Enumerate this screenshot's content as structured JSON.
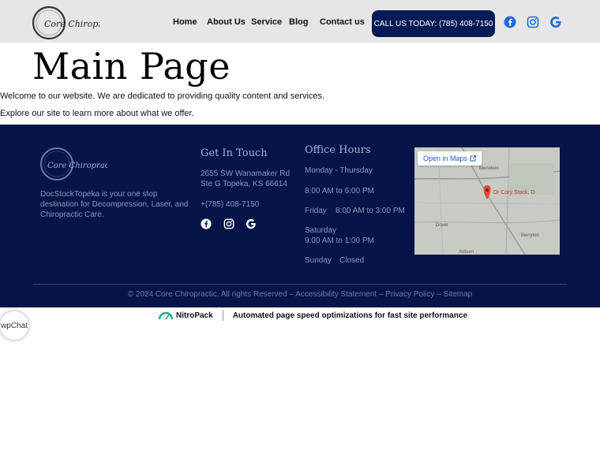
{
  "header": {
    "logo_text": "Core Chiropractic",
    "nav": [
      "Home",
      "About Us",
      "Service",
      "Blog",
      "Contact us"
    ],
    "cta": "CALL US TODAY: (785) 408-7150",
    "social_icons": [
      "facebook-icon",
      "instagram-icon",
      "google-icon"
    ],
    "accent": "#061a55"
  },
  "main": {
    "title": "Main Page",
    "paragraphs": [
      "Welcome to our website. We are dedicated to providing quality content and services.",
      "Explore our site to learn more about what we offer."
    ]
  },
  "footer": {
    "logo_text": "Core Chiropractic",
    "about": "DocStockTopeka is your one stop destination for Decompression, Laser, and Chiropractic Care.",
    "contact": {
      "heading": "Get In Touch",
      "address_line1": "2655 SW Wanamaker Rd",
      "address_line2": "Ste G Topeka, KS 66614",
      "phone": "+(785) 408-7150"
    },
    "hours": {
      "heading": "Office Hours",
      "weekdays_label": "Monday - Thursday",
      "weekdays_hours": "8:00 AM to 6:00 PM",
      "friday_label": "Friday",
      "friday_hours": "8:00 AM to 3:00 PM",
      "saturday_label": "Saturday",
      "saturday_hours": "9:00 AM to 1:00 PM",
      "sunday_label": "Sunday",
      "sunday_hours": "Closed"
    },
    "map": {
      "button": "Open in Maps",
      "pin_label": "Dr Cory Stock, D",
      "towns": [
        "Dover",
        "Auburn",
        "Berryton",
        "Menoken"
      ]
    },
    "copyright": "© 2024 Core Chiropractic. All rights Reserved – Accessibility Statement – Privacy Policy – Sitemap",
    "bg": "#061448"
  },
  "nitro": {
    "brand": "NitroPack",
    "text": "Automated page speed optimizations for fast site performance"
  },
  "chat": {
    "alt": "wpChat"
  }
}
